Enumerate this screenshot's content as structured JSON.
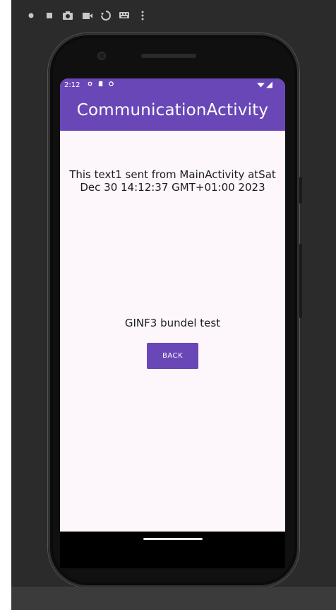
{
  "emulator_toolbar": {
    "icons": [
      "power-icon",
      "stop-icon",
      "camera-icon",
      "video-icon",
      "rotate-icon",
      "keyboard-icon",
      "more-vert-icon"
    ]
  },
  "device": {
    "status_bar": {
      "time": "2:12",
      "icons": [
        "settings-icon",
        "sd-card-icon",
        "sync-icon",
        "wifi-icon",
        "signal-icon"
      ]
    },
    "app_bar": {
      "title": "CommunicationActivity"
    },
    "content": {
      "message": "This text1 sent from MainActivity atSat Dec 30 14:12:37 GMT+01:00 2023",
      "bundle_text": "GINF3 bundel test",
      "back_button": "BACK"
    }
  },
  "colors": {
    "primary": "#6a47b7",
    "background": "#fdf7fc",
    "text": "#1c1b1f"
  }
}
